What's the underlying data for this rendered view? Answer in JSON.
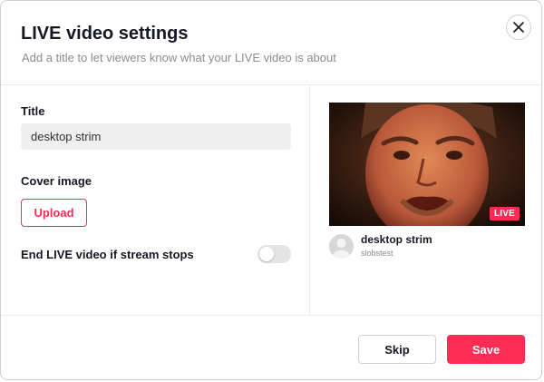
{
  "dialog": {
    "title": "LIVE video settings",
    "subtitle": "Add a title to let viewers know what your LIVE video is about"
  },
  "form": {
    "title_label": "Title",
    "title_value": "desktop strim",
    "cover_label": "Cover image",
    "upload_label": "Upload",
    "end_live_label": "End LIVE video if stream stops",
    "end_live_enabled": false
  },
  "preview": {
    "badge": "LIVE",
    "stream_title": "desktop strim",
    "username": "slobstest"
  },
  "footer": {
    "skip_label": "Skip",
    "save_label": "Save"
  },
  "colors": {
    "accent": "#fe2c55",
    "text_primary": "#161823",
    "text_secondary": "#8a8b91",
    "input_bg": "#efefef",
    "toggle_off": "#e3e3e4"
  }
}
